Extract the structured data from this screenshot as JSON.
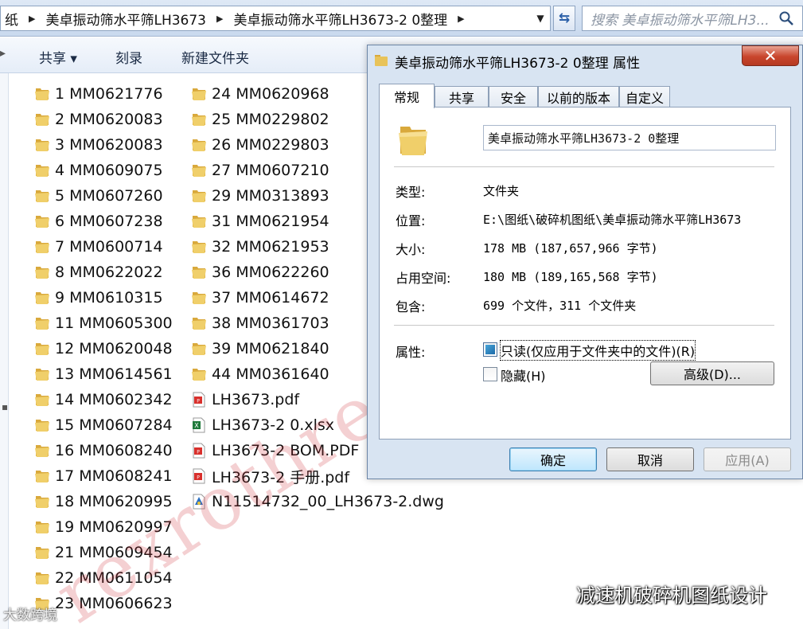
{
  "address_bar": {
    "crumbs": [
      "纸",
      "美卓振动筛水平筛LH3673",
      "美卓振动筛水平筛LH3673-2 0整理"
    ],
    "search_placeholder": "搜索 美卓振动筛水平筛LH3..."
  },
  "toolbar": {
    "share": "共享 ▾",
    "burn": "刻录",
    "new_folder": "新建文件夹"
  },
  "files": {
    "col1": [
      "1 MM0621776",
      "2 MM0620083",
      "3 MM0620083",
      "4 MM0609075",
      "5 MM0607260",
      "6 MM0607238",
      "7 MM0600714",
      "8 MM0622022",
      "9 MM0610315",
      "11 MM0605300",
      "12 MM0620048",
      "13 MM0614561",
      "14 MM0602342",
      "15 MM0607284",
      "16 MM0608240",
      "17 MM0608241",
      "18 MM0620995",
      "19 MM0620997",
      "21 MM0609454",
      "22 MM0611054",
      "23 MM0606623"
    ],
    "col2_folders": [
      "24 MM0620968",
      "25 MM0229802",
      "26 MM0229803",
      "27 MM0607210",
      "29 MM0313893",
      "31 MM0621954",
      "32 MM0621953",
      "36 MM0622260",
      "37 MM0614672",
      "38 MM0361703",
      "39 MM0621840",
      "44 MM0361640"
    ],
    "col2_files": [
      {
        "name": "LH3673.pdf",
        "icon": "pdf-icon"
      },
      {
        "name": "LH3673-2 0.xlsx",
        "icon": "excel-icon"
      },
      {
        "name": "LH3673-2 BOM.PDF",
        "icon": "pdf-icon"
      },
      {
        "name": "LH3673-2 手册.pdf",
        "icon": "pdf-icon"
      },
      {
        "name": "N11514732_00_LH3673-2.dwg",
        "icon": "dwg-icon"
      }
    ]
  },
  "dialog": {
    "title": "美卓振动筛水平筛LH3673-2 0整理 属性",
    "close": "✕",
    "tabs": [
      "常规",
      "共享",
      "安全",
      "以前的版本",
      "自定义"
    ],
    "name_value": "美卓振动筛水平筛LH3673-2 0整理",
    "props": {
      "type_label": "类型:",
      "type_value": "文件夹",
      "location_label": "位置:",
      "location_value": "E:\\图纸\\破碎机图纸\\美卓振动筛水平筛LH3673",
      "size_label": "大小:",
      "size_value": "178 MB (187,657,966 字节)",
      "disk_label": "占用空间:",
      "disk_value": "180 MB (189,165,568 字节)",
      "contains_label": "包含:",
      "contains_value": "699 个文件，311 个文件夹"
    },
    "attributes_label": "属性:",
    "readonly_label": "只读(仅应用于文件夹中的文件)(R)",
    "hidden_label": "隐藏(H)",
    "advanced_label": "高级(D)...",
    "buttons": {
      "ok": "确定",
      "cancel": "取消",
      "apply": "应用(A)"
    }
  },
  "watermark": "rexrothreducer",
  "caption": "减速机破碎机图纸设计",
  "corner_logo": "大数跨境",
  "colors": {
    "folder": "#e8c35a",
    "close_button": "#c8452c",
    "watermark": "#cd2832"
  }
}
